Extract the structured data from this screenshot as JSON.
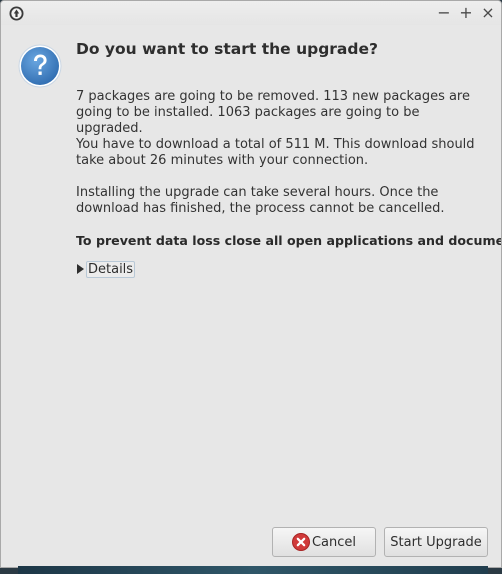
{
  "window": {
    "minimize": "−",
    "maximize": "+",
    "close": "×"
  },
  "dialog": {
    "heading": "Do you want to start the upgrade?",
    "paragraph1": "7 packages are going to be removed. 113 new packages are going to be installed. 1063 packages are going to be upgraded.",
    "paragraph2": "You have to download a total of 511 M. This download should take about 26 minutes with your connection.",
    "paragraph3": "Installing the upgrade can take several hours. Once the download has finished, the process cannot be cancelled.",
    "warning": "To prevent data loss close all open applications and documents.",
    "details_label": "Details"
  },
  "buttons": {
    "cancel": "Cancel",
    "start": "Start Upgrade"
  },
  "icons": {
    "app": "upgrade-app-icon",
    "question": "question-icon",
    "cancel": "cancel-icon"
  },
  "colors": {
    "question_blue": "#3e7fc4",
    "cancel_red": "#d03a3a"
  }
}
